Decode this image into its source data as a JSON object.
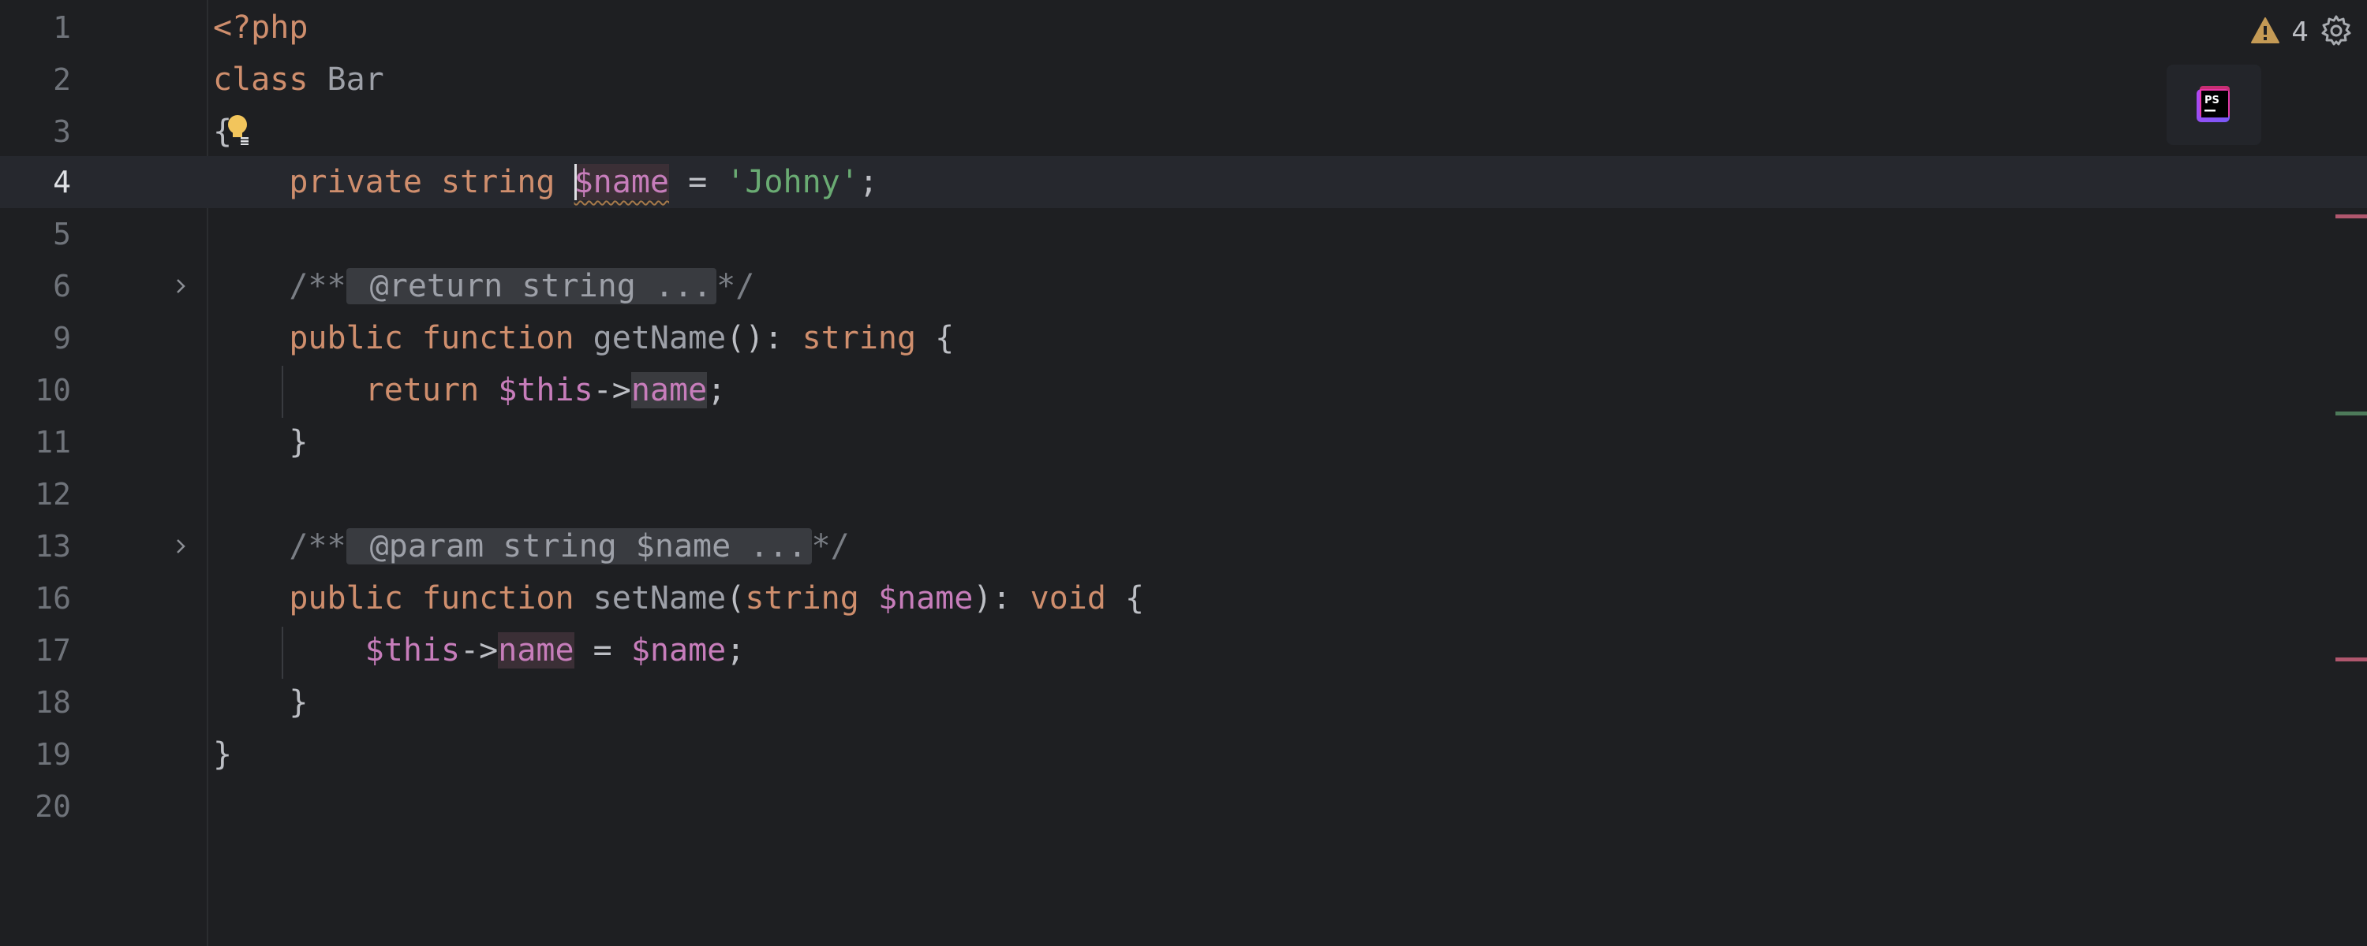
{
  "editor": {
    "lines": [
      {
        "n": "1"
      },
      {
        "n": "2"
      },
      {
        "n": "3"
      },
      {
        "n": "4"
      },
      {
        "n": "5"
      },
      {
        "n": "6"
      },
      {
        "n": "9"
      },
      {
        "n": "10"
      },
      {
        "n": "11"
      },
      {
        "n": "12"
      },
      {
        "n": "13"
      },
      {
        "n": "16"
      },
      {
        "n": "17"
      },
      {
        "n": "18"
      },
      {
        "n": "19"
      },
      {
        "n": "20"
      }
    ],
    "tokens": {
      "l1_open": "<?php",
      "l2_class": "class",
      "l2_name": "Bar",
      "l3_brace": "{",
      "l4_private": "private",
      "l4_string": "string",
      "l4_var": "$name",
      "l4_eq": " = ",
      "l4_val": "'Johny'",
      "l4_semi": ";",
      "l6_open": "/**",
      "l6_fold": " @return string ...",
      "l6_close": "*/",
      "l9_public": "public",
      "l9_function": "function",
      "l9_fn": "getName",
      "l9_rest": "(): ",
      "l9_type": "string",
      "l9_brace": " {",
      "l10_return": "return",
      "l10_this": "$this",
      "l10_arrow": "->",
      "l10_prop": "name",
      "l10_semi": ";",
      "l11_brace": "}",
      "l13_open": "/**",
      "l13_fold": " @param string $name ...",
      "l13_close": "*/",
      "l16_public": "public",
      "l16_function": "function",
      "l16_fn": "setName",
      "l16_paren": "(",
      "l16_type": "string",
      "l16_var": "$name",
      "l16_close": "): ",
      "l16_void": "void",
      "l16_brace": " {",
      "l17_this": "$this",
      "l17_arrow": "->",
      "l17_prop": "name",
      "l17_eq": " = ",
      "l17_var": "$name",
      "l17_semi": ";",
      "l18_brace": "}",
      "l19_brace": "}"
    }
  },
  "status": {
    "warning_count": "4",
    "warning_icon": "warning-triangle-icon",
    "settings_icon": "gear-icon",
    "logo": "PS"
  },
  "colors": {
    "keyword": "#cf8e6d",
    "variable": "#c77dbb",
    "string": "#6aab73",
    "comment": "#7a7e85",
    "background": "#1e1f22"
  }
}
